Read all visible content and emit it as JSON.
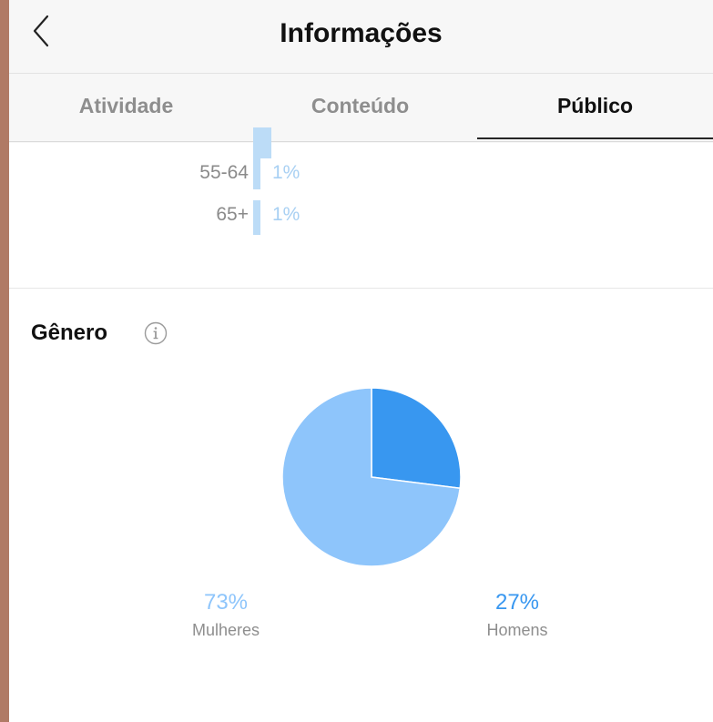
{
  "header": {
    "title": "Informações",
    "back_icon": "chevron-left-icon"
  },
  "tabs": [
    {
      "label": "Atividade",
      "active": false
    },
    {
      "label": "Conteúdo",
      "active": false
    },
    {
      "label": "Público",
      "active": true
    }
  ],
  "age_ranges": [
    {
      "label": "55-64",
      "value": "1%"
    },
    {
      "label": "65+",
      "value": "1%"
    }
  ],
  "gender": {
    "title": "Gênero",
    "info_icon": "info-icon",
    "chart_data": {
      "type": "pie",
      "categories": [
        "Mulheres",
        "Homens"
      ],
      "values": [
        73,
        27
      ],
      "colors": [
        "#8ec5fb",
        "#3897f0"
      ]
    },
    "legend": [
      {
        "pct": "73%",
        "label": "Mulheres",
        "color": "#8ec5fb"
      },
      {
        "pct": "27%",
        "label": "Homens",
        "color": "#3897f0"
      }
    ]
  }
}
